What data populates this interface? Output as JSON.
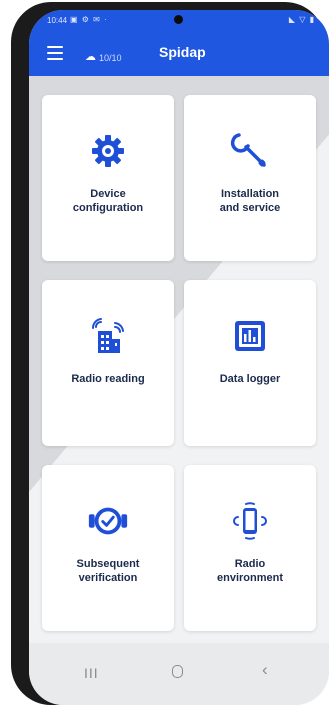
{
  "status_bar": {
    "time": "10:44",
    "icons_left": "▣ ⚙ ✉ ·",
    "icons_right": "◣ ▽ ▮"
  },
  "app_bar": {
    "title": "Spidap",
    "sync_count": "10/10"
  },
  "tiles": [
    {
      "label_line1": "Device",
      "label_line2": "configuration",
      "icon": "gear-icon"
    },
    {
      "label_line1": "Installation",
      "label_line2": "and service",
      "icon": "wrench-icon"
    },
    {
      "label_line1": "Radio reading",
      "label_line2": "",
      "icon": "radio-building-icon"
    },
    {
      "label_line1": "Data logger",
      "label_line2": "",
      "icon": "data-logger-icon"
    },
    {
      "label_line1": "Subsequent",
      "label_line2": "verification",
      "icon": "verification-badge-icon"
    },
    {
      "label_line1": "Radio",
      "label_line2": "environment",
      "icon": "vibrating-phone-icon"
    }
  ],
  "nav_bar": {
    "recents": "III",
    "back": "‹"
  },
  "colors": {
    "primary": "#1f57e0",
    "icon": "#1f4fd6",
    "label": "#1b2a4d"
  }
}
